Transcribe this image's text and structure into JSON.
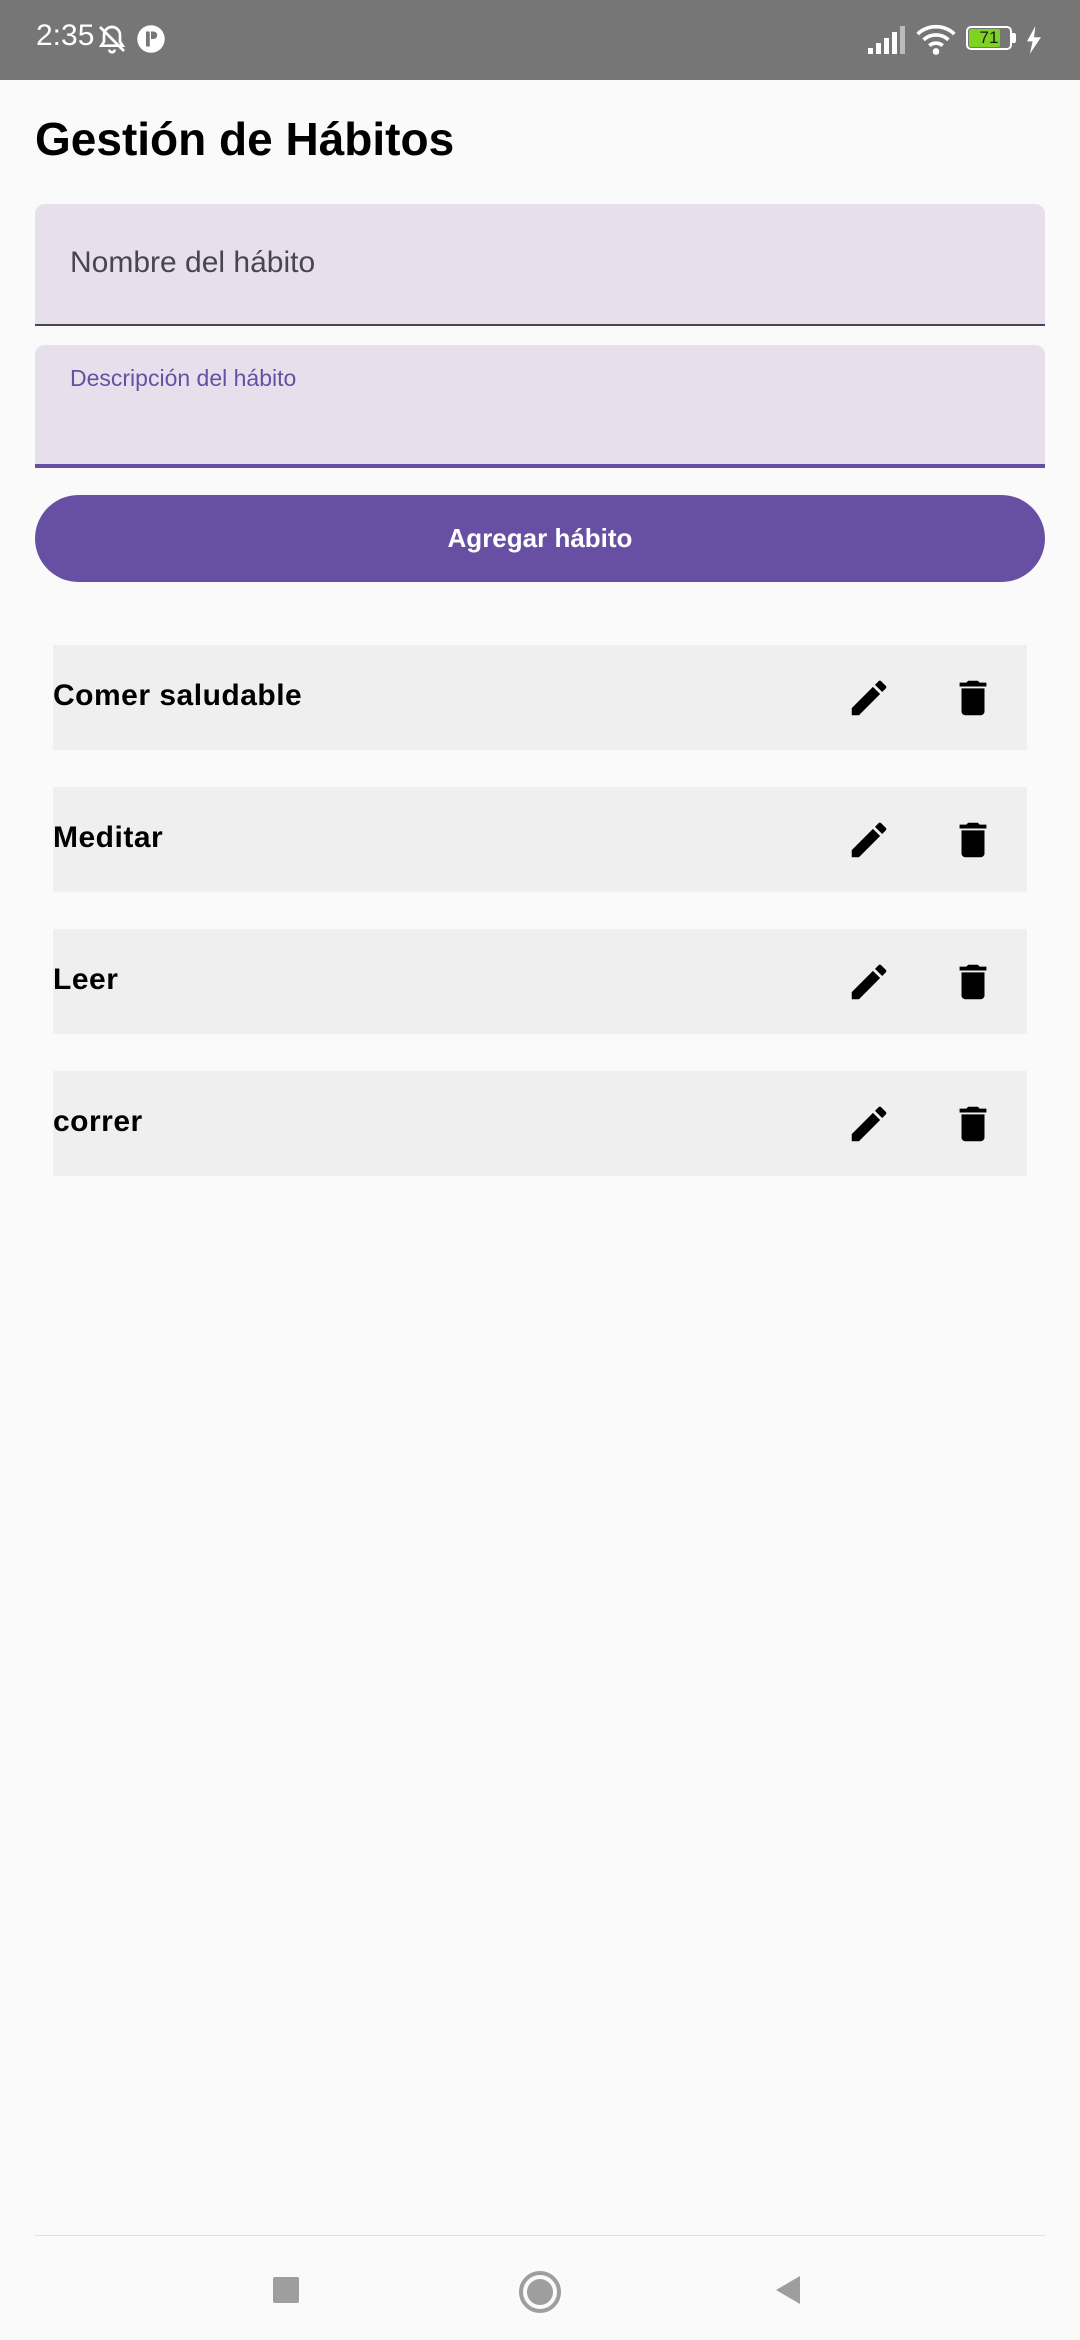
{
  "status_bar": {
    "time": "2:35",
    "battery": "71",
    "icons": [
      "bell-off-icon",
      "app-notification-icon",
      "signal-icon",
      "wifi-icon",
      "battery-icon",
      "charging-icon"
    ]
  },
  "header": {
    "title": "Gestión de Hábitos"
  },
  "form": {
    "name_placeholder": "Nombre del hábito",
    "description_label": "Descripción del hábito",
    "description_value": "",
    "add_button_label": "Agregar hábito"
  },
  "habits": [
    {
      "name": "Comer saludable"
    },
    {
      "name": "Meditar"
    },
    {
      "name": "Leer"
    },
    {
      "name": "correr"
    }
  ],
  "actions": {
    "edit_icon": "edit-icon",
    "delete_icon": "delete-icon"
  },
  "nav_bar": {
    "buttons": [
      "recents-button",
      "home-button",
      "back-button"
    ]
  },
  "colors": {
    "primary": "#6750a4",
    "field_bg": "#e7e0ec",
    "row_bg": "#efefef",
    "status_bar": "#767676",
    "background": "#fafafa"
  }
}
